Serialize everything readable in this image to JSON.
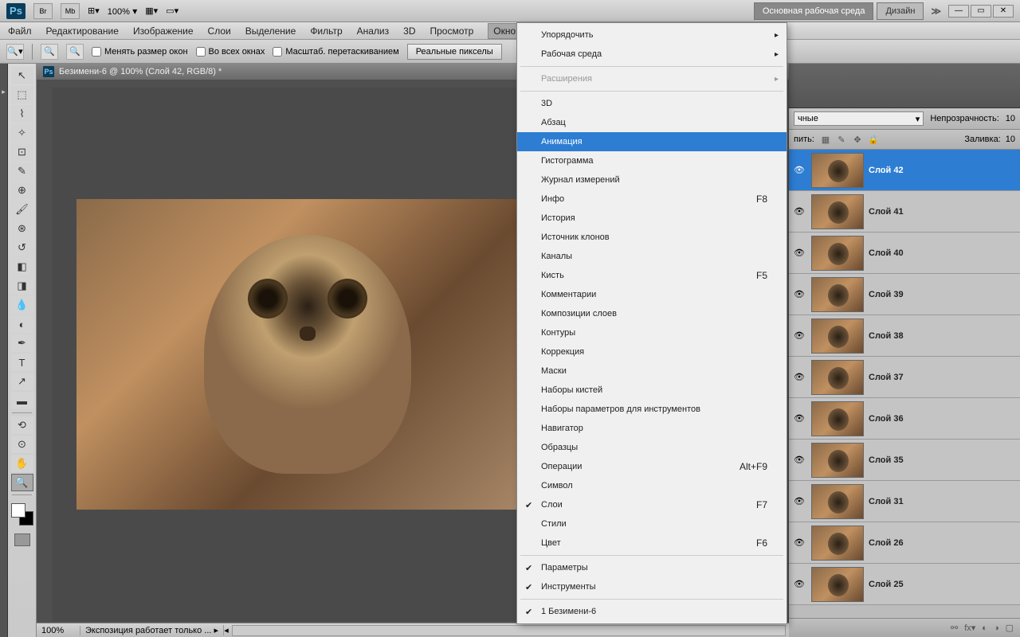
{
  "top": {
    "br": "Br",
    "mb": "Mb",
    "zoom": "100%"
  },
  "workspace": {
    "main": "Основная рабочая среда",
    "design": "Дизайн"
  },
  "menu": {
    "file": "Файл",
    "edit": "Редактирование",
    "image": "Изображение",
    "layer": "Слои",
    "select": "Выделение",
    "filter": "Фильтр",
    "analysis": "Анализ",
    "threed": "3D",
    "view": "Просмотр",
    "window": "Окно"
  },
  "options": {
    "resize": "Менять размер окон",
    "allwin": "Во всех окнах",
    "scrub": "Масштаб. перетаскиванием",
    "realpx": "Реальные пикселы"
  },
  "doc": {
    "title": "Безимени-6 @ 100% (Слой 42, RGB/8) *"
  },
  "status": {
    "zoom": "100%",
    "info": "Экспозиция работает только ..."
  },
  "dropdown": {
    "arrange": "Упорядочить",
    "workspace": "Рабочая среда",
    "extensions": "Расширения",
    "threed": "3D",
    "paragraph": "Абзац",
    "animation": "Анимация",
    "histogram": "Гистограмма",
    "measurelog": "Журнал измерений",
    "info": "Инфо",
    "info_sc": "F8",
    "history": "История",
    "clonesrc": "Источник клонов",
    "channels": "Каналы",
    "brush": "Кисть",
    "brush_sc": "F5",
    "comments": "Комментарии",
    "layercomps": "Композиции слоев",
    "paths": "Контуры",
    "adjustments": "Коррекция",
    "masks": "Маски",
    "brushsets": "Наборы кистей",
    "toolpresets": "Наборы параметров для инструментов",
    "navigator": "Навигатор",
    "swatches": "Образцы",
    "actions": "Операции",
    "actions_sc": "Alt+F9",
    "character": "Символ",
    "layers": "Слои",
    "layers_sc": "F7",
    "styles": "Стили",
    "color": "Цвет",
    "color_sc": "F6",
    "options_item": "Параметры",
    "tools": "Инструменты",
    "doc1": "1 Безимени-6"
  },
  "layers_panel": {
    "blend_suffix": "чные",
    "opacity_label": "Непрозрачность:",
    "opacity_val": "10",
    "lock_label": "пить:",
    "fill_label": "Заливка:",
    "fill_val": "10",
    "items": [
      {
        "name": "Слой 42",
        "selected": true
      },
      {
        "name": "Слой 41"
      },
      {
        "name": "Слой 40"
      },
      {
        "name": "Слой 39"
      },
      {
        "name": "Слой 38"
      },
      {
        "name": "Слой 37"
      },
      {
        "name": "Слой 36"
      },
      {
        "name": "Слой 35"
      },
      {
        "name": "Слой 31"
      },
      {
        "name": "Слой 26"
      },
      {
        "name": "Слой 25"
      }
    ]
  }
}
